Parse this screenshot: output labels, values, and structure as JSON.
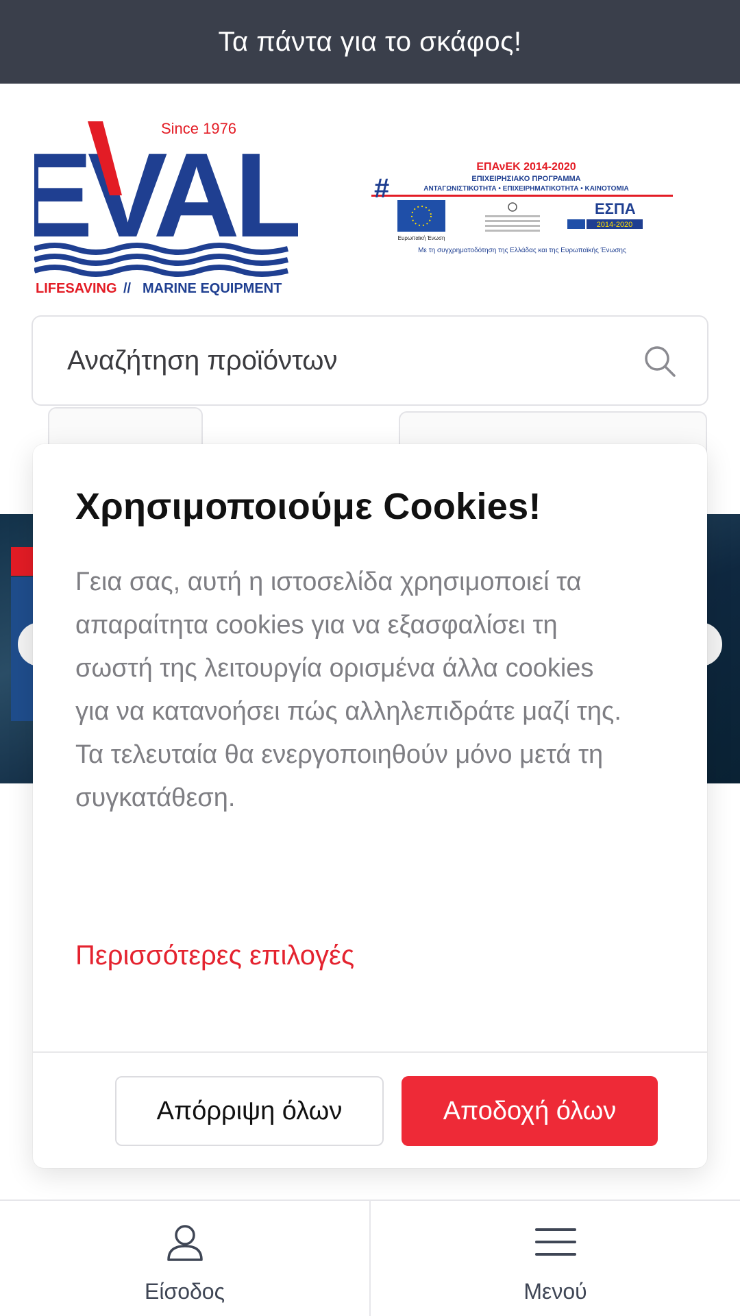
{
  "topbar": {
    "tagline": "Τα πάντα για το σκάφος!"
  },
  "logo": {
    "since": "Since 1976",
    "brand": "EVAL",
    "subtitle_left": "LIFESAVING",
    "subtitle_sep": "//",
    "subtitle_right": "MARINE EQUIPMENT"
  },
  "espa": {
    "title": "ΕΠΑνΕΚ 2014-2020",
    "line1": "ΕΠΙΧΕΙΡΗΣΙΑΚΟ ΠΡΟΓΡΑΜΜΑ",
    "line2": "ΑΝΤΑΓΩΝΙΣΤΙΚΟΤΗΤΑ • ΕΠΙΧΕΙΡΗΜΑΤΙΚΟΤΗΤΑ • ΚΑΙΝΟΤΟΜΙΑ",
    "eu": "Ευρωπαϊκή Ένωση",
    "espa_label": "ΕΣΠΑ",
    "espa_years": "2014-2020",
    "footer": "Με τη συγχρηματοδότηση της Ελλάδας και της Ευρωπαϊκής Ένωσης"
  },
  "search": {
    "placeholder": "Αναζήτηση προϊόντων"
  },
  "cookie_modal": {
    "title": "Χρησιμοποιούμε Cookies!",
    "body": "Γεια σας, αυτή η ιστοσελίδα χρησιμοποιεί τα απαραίτητα cookies για να εξασφαλίσει τη σωστή της λειτουργία ορισμένα άλλα cookies για να κατανοήσει πώς αλληλεπιδράτε μαζί της. Τα τελευταία θα ενεργοποιηθούν μόνο μετά τη συγκατάθεση.",
    "more_options": "Περισσότερες επιλογές",
    "reject_all": "Απόρριψη όλων",
    "accept_all": "Αποδοχή όλων"
  },
  "bottom_nav": {
    "items": [
      {
        "label": "Είσοδος",
        "icon": "user-icon"
      },
      {
        "label": "Μενού",
        "icon": "hamburger-menu-icon"
      }
    ]
  },
  "colors": {
    "topbar": "#3a3f4b",
    "accent_red": "#ee2a37",
    "brand_blue": "#1f3f91",
    "brand_red": "#e31c25"
  }
}
